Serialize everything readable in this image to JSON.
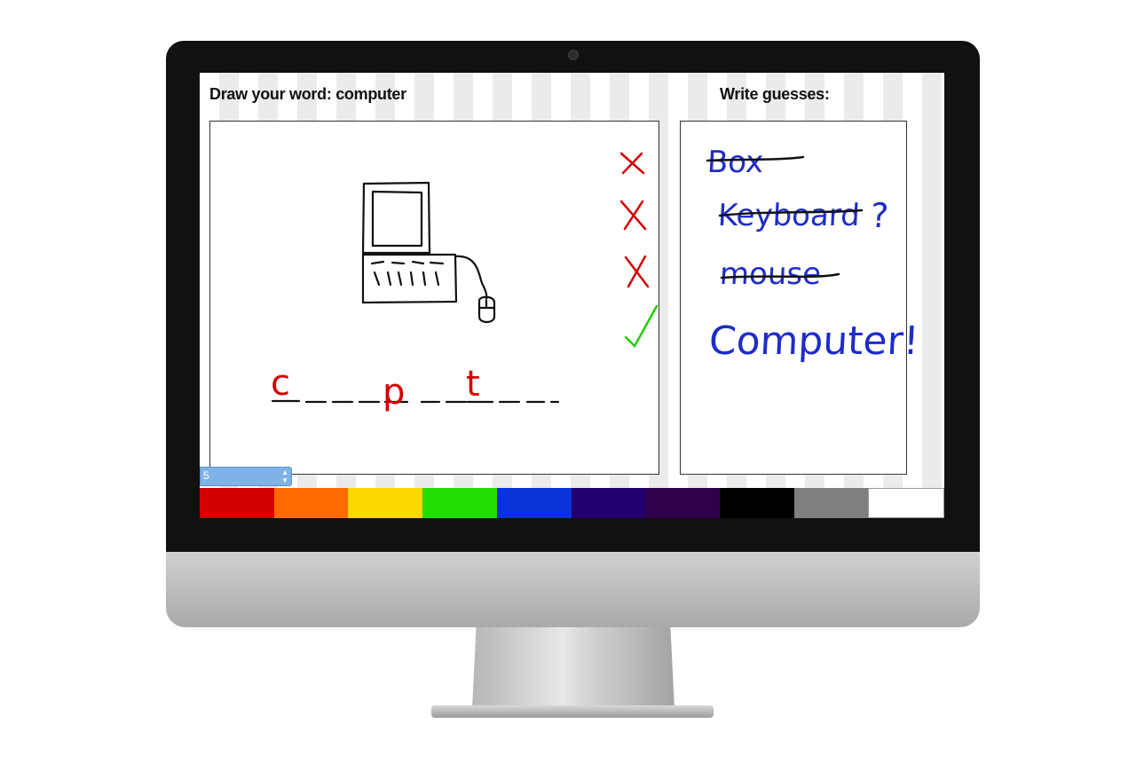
{
  "draw": {
    "heading": "Draw your word: computer",
    "hint_letters": [
      "c",
      "p",
      "t"
    ],
    "marks": [
      "wrong",
      "wrong",
      "wrong",
      "correct"
    ]
  },
  "guesses": {
    "heading": "Write guesses:",
    "items": [
      {
        "text": "Box",
        "crossed": true
      },
      {
        "text": "Keyboard",
        "crossed": true,
        "suffix": "?"
      },
      {
        "text": "mouse",
        "crossed": true
      },
      {
        "text": "Computer!",
        "crossed": false
      }
    ]
  },
  "brush": {
    "size": "5"
  },
  "palette": [
    {
      "name": "red",
      "color": "#d40000"
    },
    {
      "name": "orange",
      "color": "#ff6a00"
    },
    {
      "name": "yellow",
      "color": "#ffd800"
    },
    {
      "name": "green",
      "color": "#22dd00"
    },
    {
      "name": "blue",
      "color": "#0a32d8"
    },
    {
      "name": "indigo",
      "color": "#21006e"
    },
    {
      "name": "violet",
      "color": "#32004a"
    },
    {
      "name": "black",
      "color": "#000000"
    },
    {
      "name": "gray",
      "color": "#808080"
    },
    {
      "name": "white",
      "color": "#ffffff"
    }
  ],
  "colors": {
    "wrong_mark": "#d40000",
    "correct_mark": "#22cc00",
    "hint_letter": "#d40000",
    "guess_ink": "#1e2cc8"
  }
}
